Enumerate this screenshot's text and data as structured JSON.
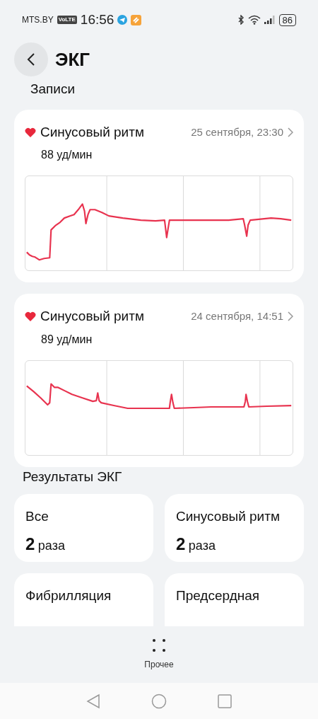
{
  "status_bar": {
    "carrier": "MTS.BY",
    "volte": "VoLTE",
    "time": "16:56",
    "battery": "86"
  },
  "header": {
    "title": "ЭКГ"
  },
  "records_title": "Записи",
  "records": [
    {
      "rhythm": "Синусовый ритм",
      "date": "25 сентября, 23:30",
      "rate": "88 уд/мин"
    },
    {
      "rhythm": "Синусовый ритм",
      "date": "24 сентября, 14:51",
      "rate": "89 уд/мин"
    }
  ],
  "results_title": "Результаты ЭКГ",
  "results": [
    {
      "label": "Все",
      "count": "2",
      "unit": "раза"
    },
    {
      "label": "Синусовый ритм",
      "count": "2",
      "unit": "раза"
    },
    {
      "label": "Фибрилляция"
    },
    {
      "label": "Предсердная"
    }
  ],
  "bottom_action": {
    "label": "Прочее"
  }
}
